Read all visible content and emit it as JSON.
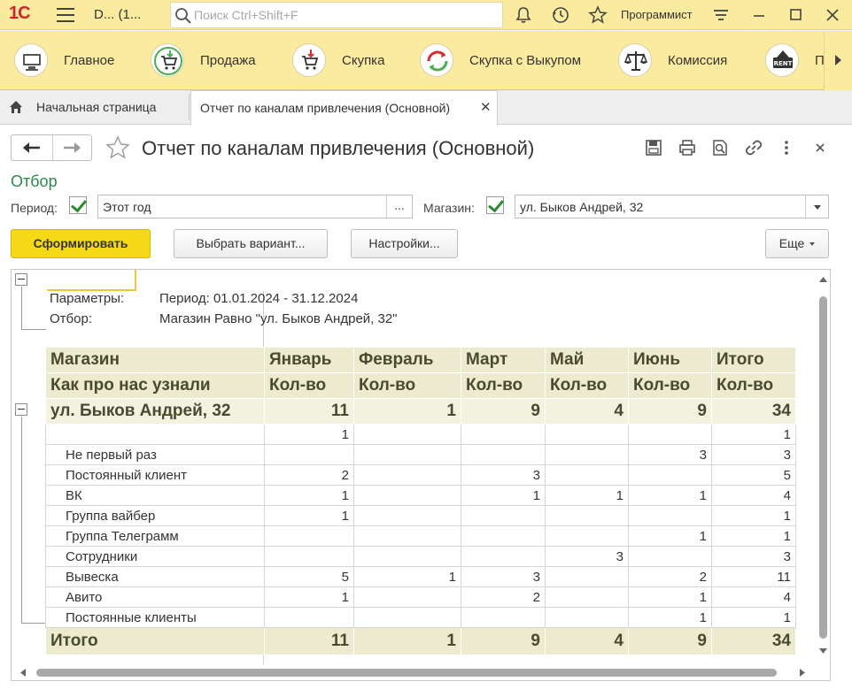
{
  "titlebar": {
    "logo": "1С",
    "app_title": "D...  (1...",
    "search_placeholder": "Поиск Ctrl+Shift+F",
    "username": "Программист"
  },
  "sections": [
    {
      "label": "Главное",
      "icon": "desktop-icon"
    },
    {
      "label": "Продажа",
      "icon": "cart-icon"
    },
    {
      "label": "Скупка",
      "icon": "cart-in-icon"
    },
    {
      "label": "Скупка с Выкупом",
      "icon": "cycle-arrows-icon"
    },
    {
      "label": "Комиссия",
      "icon": "scales-icon"
    },
    {
      "label": "П",
      "icon": "rent-icon"
    }
  ],
  "tabs": {
    "home": "Начальная страница",
    "report": "Отчет по каналам привлечения (Основной)",
    "close": "✕"
  },
  "form": {
    "title": "Отчет по каналам привлечения (Основной)",
    "filter_title": "Отбор",
    "period_label": "Период:",
    "period_value": "Этот год",
    "period_choose": "...",
    "shop_label": "Магазин:",
    "shop_value": "ул. Быков Андрей, 32",
    "btn_generate": "Сформировать",
    "btn_variant": "Выбрать вариант...",
    "btn_settings": "Настройки...",
    "btn_more": "Еще"
  },
  "report": {
    "params_label": "Параметры:",
    "params_value": "Период: 01.01.2024 - 31.12.2024",
    "filter_label": "Отбор:",
    "filter_value": "Магазин Равно \"ул. Быков Андрей, 32\"",
    "header1": [
      "Магазин",
      "Январь",
      "Февраль",
      "Март",
      "Май",
      "Июнь",
      "Итого"
    ],
    "header2": [
      "Как про нас узнали",
      "Кол-во",
      "Кол-во",
      "Кол-во",
      "Кол-во",
      "Кол-во",
      "Кол-во"
    ],
    "group_row": [
      "ул. Быков Андрей, 32",
      "11",
      "1",
      "9",
      "4",
      "9",
      "34"
    ],
    "rows": [
      [
        "",
        "1",
        "",
        "",
        "",
        "",
        "1"
      ],
      [
        "Не первый раз",
        "",
        "",
        "",
        "",
        "3",
        "3"
      ],
      [
        "Постоянный клиент",
        "2",
        "",
        "3",
        "",
        "",
        "5"
      ],
      [
        "ВК",
        "1",
        "",
        "1",
        "1",
        "1",
        "4"
      ],
      [
        "Группа вайбер",
        "1",
        "",
        "",
        "",
        "",
        "1"
      ],
      [
        "Группа Телеграмм",
        "",
        "",
        "",
        "",
        "1",
        "1"
      ],
      [
        "Сотрудники",
        "",
        "",
        "",
        "3",
        "",
        "3"
      ],
      [
        "Вывеска",
        "5",
        "1",
        "3",
        "",
        "2",
        "11"
      ],
      [
        "Авито",
        "1",
        "",
        "2",
        "",
        "1",
        "4"
      ],
      [
        "Постоянные клиенты",
        "",
        "",
        "",
        "",
        "1",
        "1"
      ]
    ],
    "total_row": [
      "Итого",
      "11",
      "1",
      "9",
      "4",
      "9",
      "34"
    ]
  }
}
